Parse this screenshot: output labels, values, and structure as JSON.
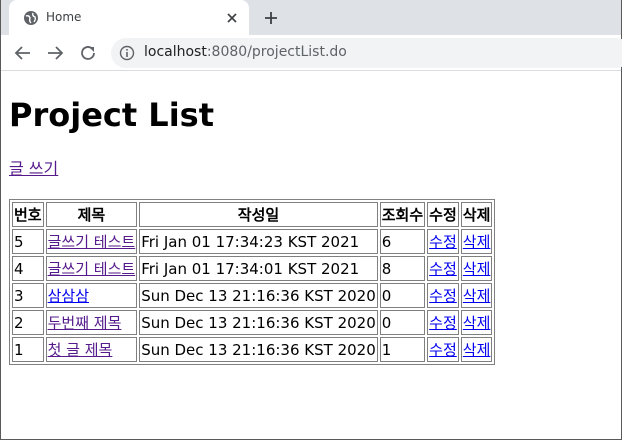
{
  "browser": {
    "tab_title": "Home",
    "url_host": "localhost",
    "url_rest": ":8080/projectList.do"
  },
  "icons": {
    "favicon": "globe-icon",
    "tab_close": "close-icon",
    "new_tab": "plus-icon",
    "back": "arrow-left-icon",
    "forward": "arrow-right-icon",
    "reload": "reload-icon",
    "site_info": "info-icon"
  },
  "page": {
    "heading": "Project List",
    "write_link": "글 쓰기"
  },
  "table": {
    "headers": [
      "번호",
      "제목",
      "작성일",
      "조회수",
      "수정",
      "삭제"
    ],
    "rows": [
      {
        "num": "5",
        "title": "글쓰기 테스트",
        "date": "Fri Jan 01 17:34:23 KST 2021",
        "views": "6",
        "edit": "수정",
        "delete": "삭제"
      },
      {
        "num": "4",
        "title": "글쓰기 테스트",
        "date": "Fri Jan 01 17:34:01 KST 2021",
        "views": "8",
        "edit": "수정",
        "delete": "삭제"
      },
      {
        "num": "3",
        "title": "삼삼삼",
        "date": "Sun Dec 13 21:16:36 KST 2020",
        "views": "0",
        "edit": "수정",
        "delete": "삭제"
      },
      {
        "num": "2",
        "title": "두번째 제목",
        "date": "Sun Dec 13 21:16:36 KST 2020",
        "views": "0",
        "edit": "수정",
        "delete": "삭제"
      },
      {
        "num": "1",
        "title": "첫 글 제목",
        "date": "Sun Dec 13 21:16:36 KST 2020",
        "views": "1",
        "edit": "수정",
        "delete": "삭제"
      }
    ]
  },
  "colors": {
    "link": "#0000ee",
    "visited_link": "#551a8b",
    "tabstrip_bg": "#dee1e6"
  }
}
